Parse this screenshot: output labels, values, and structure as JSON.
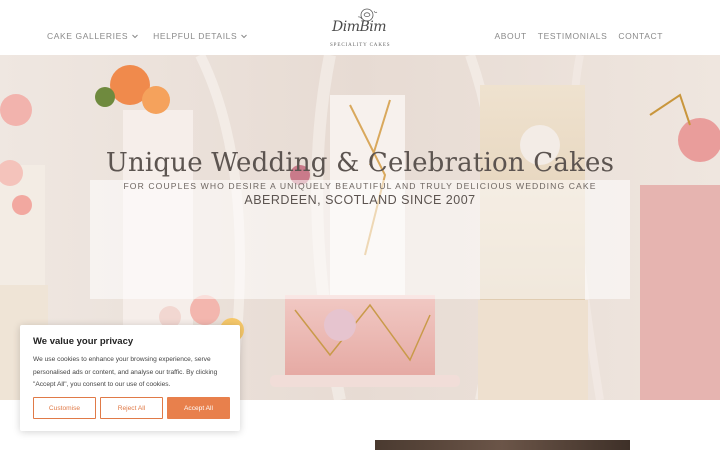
{
  "header": {
    "nav_left": [
      {
        "label": "CAKE GALLERIES",
        "has_dropdown": true,
        "icon": "chevron-down-icon"
      },
      {
        "label": "HELPFUL DETAILS",
        "has_dropdown": true,
        "icon": "chevron-down-icon"
      }
    ],
    "logo": {
      "script": "DimBim",
      "subtitle": "SPECIALITY CAKES",
      "icon": "rose-icon"
    },
    "nav_right": [
      {
        "label": "ABOUT"
      },
      {
        "label": "TESTIMONIALS"
      },
      {
        "label": "CONTACT"
      }
    ]
  },
  "hero": {
    "title": "Unique Wedding & Celebration Cakes",
    "subtitle": "FOR COUPLES WHO DESIRE A UNIQUELY BEAUTIFUL AND TRULY DELICIOUS WEDDING CAKE",
    "location": "ABERDEEN, SCOTLAND SINCE 2007"
  },
  "cookie_banner": {
    "title": "We value your privacy",
    "text": "We use cookies to enhance your browsing experience, serve personalised ads or content, and analyse our traffic. By clicking \"Accept All\", you consent to our use of cookies.",
    "buttons": {
      "customise": "Customise",
      "reject": "Reject All",
      "accept": "Accept All"
    }
  },
  "colors": {
    "accent": "#e8804c",
    "nav_text": "#8a8a8a",
    "title_text": "#5c5450"
  }
}
